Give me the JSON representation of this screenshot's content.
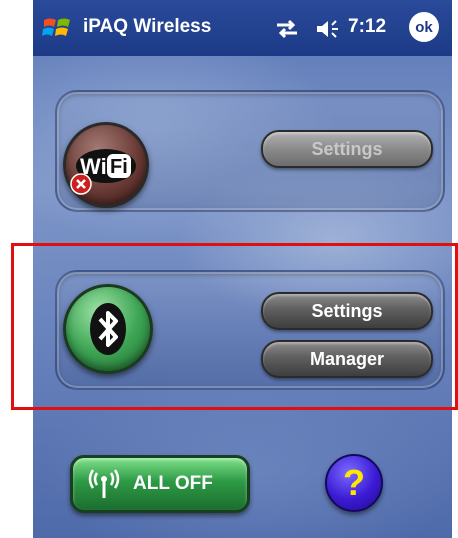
{
  "titlebar": {
    "title": "iPAQ Wireless",
    "time": "7:12",
    "ok_label": "ok",
    "start_icon": "windows-flag-icon",
    "connectivity_icon": "sync-arrows-icon",
    "volume_icon": "speaker-icon"
  },
  "wifi_panel": {
    "icon": "wifi-icon",
    "icon_text_wi": "Wi",
    "icon_text_fi": "Fi",
    "status_badge": "disabled-x-icon",
    "settings_label": "Settings",
    "settings_enabled": false
  },
  "bluetooth_panel": {
    "icon": "bluetooth-icon",
    "settings_label": "Settings",
    "manager_label": "Manager"
  },
  "footer": {
    "all_off_label": "ALL OFF",
    "all_off_icon": "antenna-icon",
    "help_label": "?"
  },
  "colors": {
    "title_bar": "#1c3a86",
    "highlight_box": "#e01010",
    "bluetooth_green": "#3fa656",
    "help_yellow": "#ffe700"
  }
}
